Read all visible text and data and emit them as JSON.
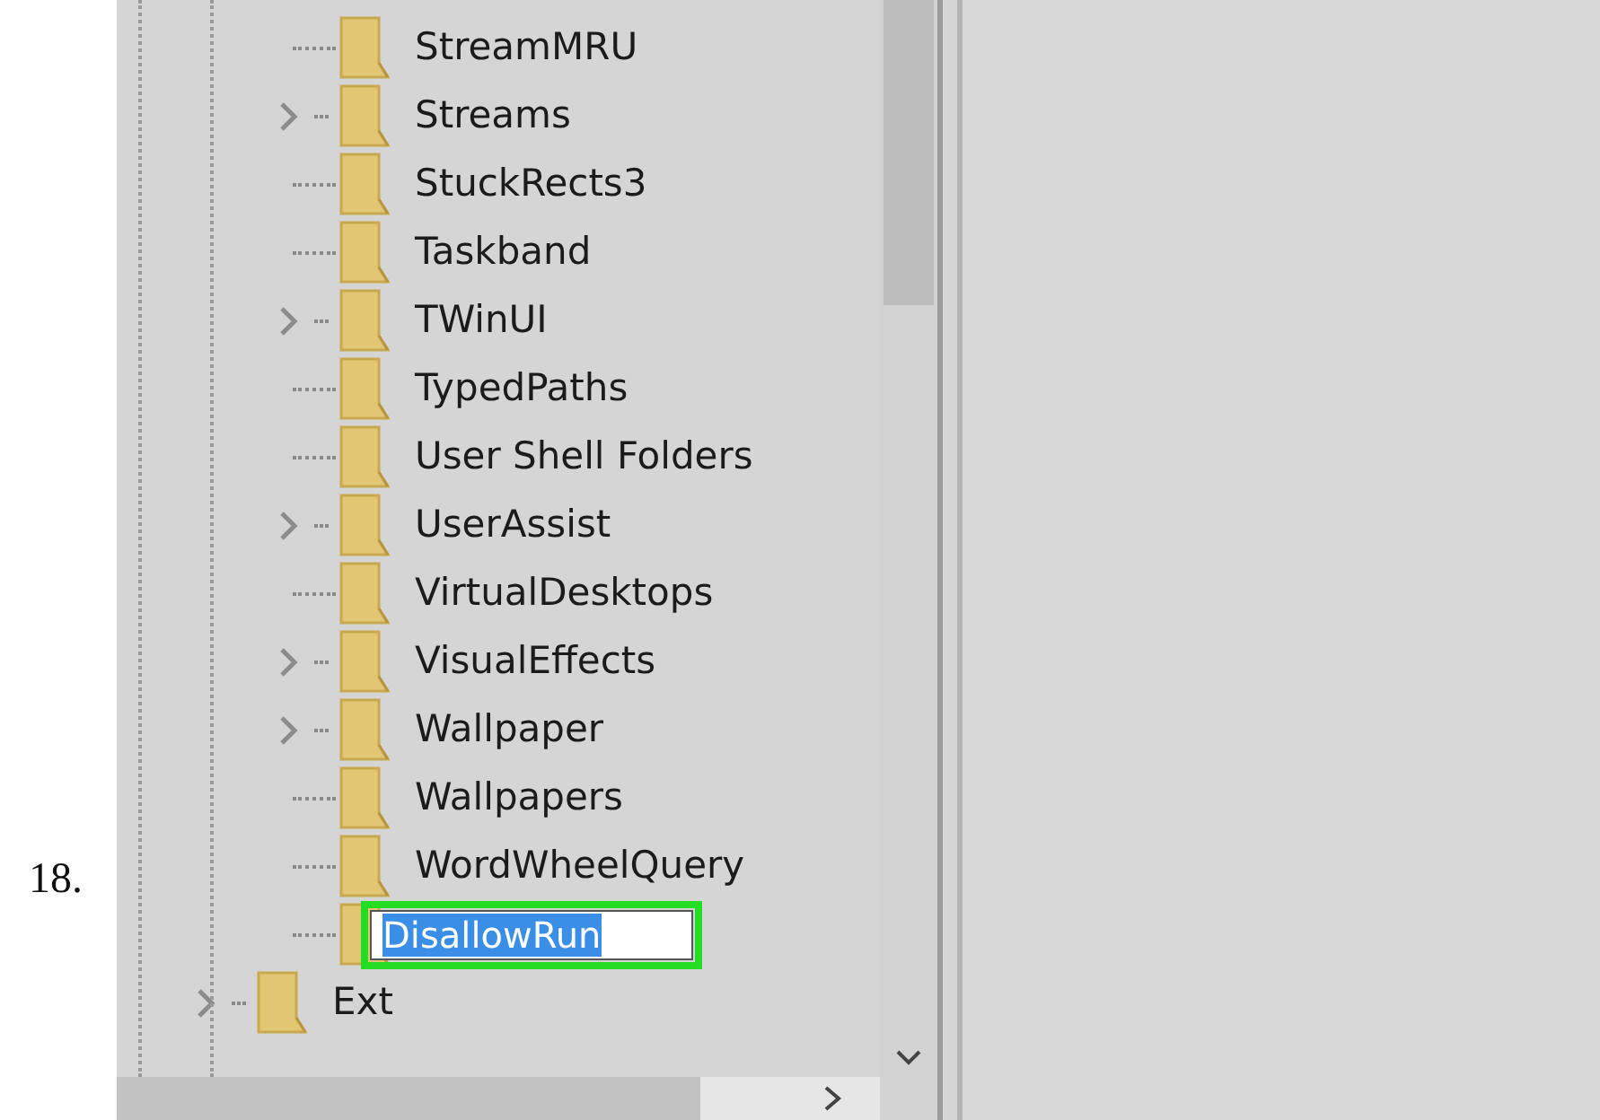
{
  "step_number": "18.",
  "tree": {
    "items": [
      {
        "children": [
          {
            "label": "StreamMRU",
            "expandable": false
          },
          {
            "label": "Streams",
            "expandable": true
          },
          {
            "label": "StuckRects3",
            "expandable": false
          },
          {
            "label": "Taskband",
            "expandable": false
          },
          {
            "label": "TWinUI",
            "expandable": true
          },
          {
            "label": "TypedPaths",
            "expandable": false
          },
          {
            "label": "User Shell Folders",
            "expandable": false
          },
          {
            "label": "UserAssist",
            "expandable": true
          },
          {
            "label": "VirtualDesktops",
            "expandable": false
          },
          {
            "label": "VisualEffects",
            "expandable": true
          },
          {
            "label": "Wallpaper",
            "expandable": true
          },
          {
            "label": "Wallpapers",
            "expandable": false
          },
          {
            "label": "WordWheelQuery",
            "expandable": false
          },
          {
            "kind": "rename",
            "value": "DisallowRun",
            "text_selected": true,
            "highlighted": true
          }
        ]
      },
      {
        "label": "Ext",
        "expandable": true
      }
    ]
  }
}
